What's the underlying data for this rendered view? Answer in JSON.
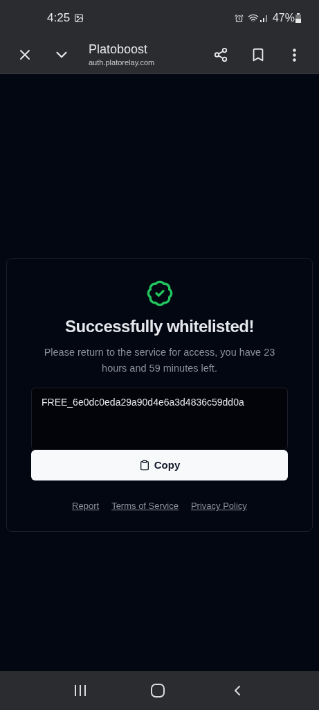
{
  "status_bar": {
    "time": "4:25",
    "battery": "47%"
  },
  "toolbar": {
    "title": "Platoboost",
    "url": "auth.platorelay.com"
  },
  "card": {
    "title": "Successfully whitelisted!",
    "message": "Please return to the service for access, you have 23 hours and 59 minutes left.",
    "key_value": "FREE_6e0dc0eda29a90d4e6a3d4836c59dd0a",
    "copy_button": "Copy",
    "links": [
      "Report",
      "Terms of Service",
      "Privacy Policy"
    ]
  }
}
